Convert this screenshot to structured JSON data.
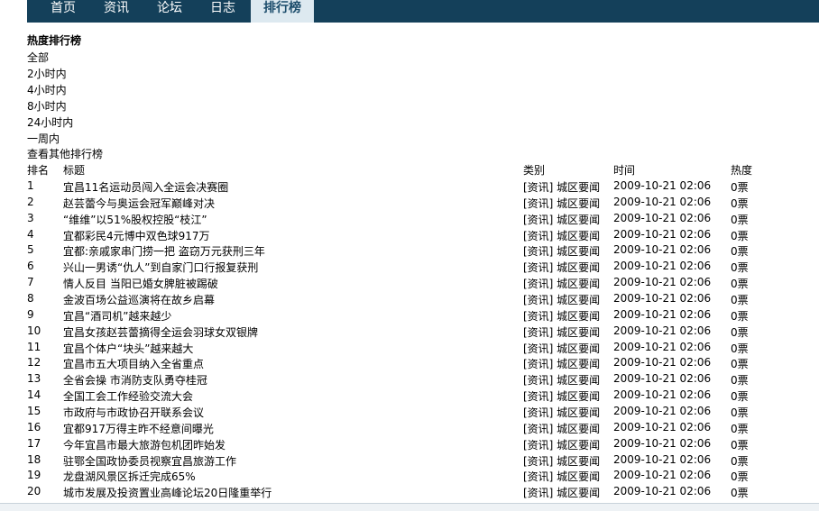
{
  "nav": {
    "items": [
      {
        "label": "首页"
      },
      {
        "label": "资讯"
      },
      {
        "label": "论坛"
      },
      {
        "label": "日志"
      },
      {
        "label": "排行榜"
      }
    ]
  },
  "sidebar": {
    "title": "热度排行榜",
    "filters": [
      "全部",
      "2小时内",
      "4小时内",
      "8小时内",
      "24小时内",
      "一周内",
      "查看其他排行榜"
    ]
  },
  "table": {
    "headers": {
      "rank": "排名",
      "title": "标题",
      "category": "类别",
      "time": "时间",
      "heat": "热度"
    },
    "rows": [
      {
        "rank": "1",
        "title": "宜昌11名运动员闯入全运会决赛圈",
        "category": "[资讯] 城区要闻",
        "time": "2009-10-21 02:06",
        "heat": "0票"
      },
      {
        "rank": "2",
        "title": "赵芸蕾今与奥运会冠军巅峰对决",
        "category": "[资讯] 城区要闻",
        "time": "2009-10-21 02:06",
        "heat": "0票"
      },
      {
        "rank": "3",
        "title": "“维维”以51%股权控股“枝江”",
        "category": "[资讯] 城区要闻",
        "time": "2009-10-21 02:06",
        "heat": "0票"
      },
      {
        "rank": "4",
        "title": "宜都彩民4元博中双色球917万",
        "category": "[资讯] 城区要闻",
        "time": "2009-10-21 02:06",
        "heat": "0票"
      },
      {
        "rank": "5",
        "title": "宜都:亲戚家串门捞一把 盗窃万元获刑三年",
        "category": "[资讯] 城区要闻",
        "time": "2009-10-21 02:06",
        "heat": "0票"
      },
      {
        "rank": "6",
        "title": "兴山一男诱“仇人”到自家门口行报复获刑",
        "category": "[资讯] 城区要闻",
        "time": "2009-10-21 02:06",
        "heat": "0票"
      },
      {
        "rank": "7",
        "title": "情人反目 当阳已婚女脾脏被踢破",
        "category": "[资讯] 城区要闻",
        "time": "2009-10-21 02:06",
        "heat": "0票"
      },
      {
        "rank": "8",
        "title": "金波百场公益巡演将在故乡启幕",
        "category": "[资讯] 城区要闻",
        "time": "2009-10-21 02:06",
        "heat": "0票"
      },
      {
        "rank": "9",
        "title": "宜昌“酒司机”越来越少",
        "category": "[资讯] 城区要闻",
        "time": "2009-10-21 02:06",
        "heat": "0票"
      },
      {
        "rank": "10",
        "title": "宜昌女孩赵芸蕾摘得全运会羽球女双银牌",
        "category": "[资讯] 城区要闻",
        "time": "2009-10-21 02:06",
        "heat": "0票"
      },
      {
        "rank": "11",
        "title": "宜昌个体户“块头”越来越大",
        "category": "[资讯] 城区要闻",
        "time": "2009-10-21 02:06",
        "heat": "0票"
      },
      {
        "rank": "12",
        "title": "宜昌市五大项目纳入全省重点",
        "category": "[资讯] 城区要闻",
        "time": "2009-10-21 02:06",
        "heat": "0票"
      },
      {
        "rank": "13",
        "title": "全省会操 市消防支队勇夺桂冠",
        "category": "[资讯] 城区要闻",
        "time": "2009-10-21 02:06",
        "heat": "0票"
      },
      {
        "rank": "14",
        "title": "全国工会工作经验交流大会",
        "category": "[资讯] 城区要闻",
        "time": "2009-10-21 02:06",
        "heat": "0票"
      },
      {
        "rank": "15",
        "title": "市政府与市政协召开联系会议",
        "category": "[资讯] 城区要闻",
        "time": "2009-10-21 02:06",
        "heat": "0票"
      },
      {
        "rank": "16",
        "title": "宜都917万得主昨不经意间曝光",
        "category": "[资讯] 城区要闻",
        "time": "2009-10-21 02:06",
        "heat": "0票"
      },
      {
        "rank": "17",
        "title": "今年宜昌市最大旅游包机团昨始发",
        "category": "[资讯] 城区要闻",
        "time": "2009-10-21 02:06",
        "heat": "0票"
      },
      {
        "rank": "18",
        "title": "驻鄂全国政协委员视察宜昌旅游工作",
        "category": "[资讯] 城区要闻",
        "time": "2009-10-21 02:06",
        "heat": "0票"
      },
      {
        "rank": "19",
        "title": "龙盘湖风景区拆迁完成65%",
        "category": "[资讯] 城区要闻",
        "time": "2009-10-21 02:06",
        "heat": "0票"
      },
      {
        "rank": "20",
        "title": "城市发展及投资置业高峰论坛20日隆重举行",
        "category": "[资讯] 城区要闻",
        "time": "2009-10-21 02:06",
        "heat": "0票"
      }
    ]
  }
}
